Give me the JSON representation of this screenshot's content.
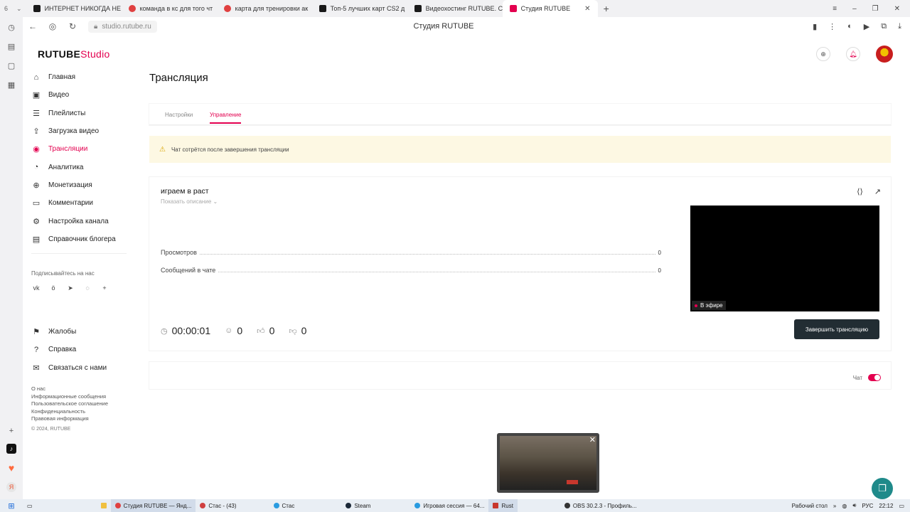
{
  "browser": {
    "tab_counter": "6",
    "tabs": [
      {
        "label": "ИНТЕРНЕТ НИКОГДА НЕ",
        "color": "#1a1a1a"
      },
      {
        "label": "команда в кс для того чт",
        "color": "#e04040"
      },
      {
        "label": "карта для тренировки ак",
        "color": "#e04040"
      },
      {
        "label": "Топ-5 лучших карт CS2 д",
        "color": "#1a1a1a"
      },
      {
        "label": "Видеохостинг RUTUBE. С",
        "color": "#1a1a1a"
      },
      {
        "label": "Студия RUTUBE",
        "color": "#e3004f",
        "active": true
      }
    ],
    "url": "studio.rutube.ru",
    "page_title": "Студия RUTUBE"
  },
  "app": {
    "logo_main": "RUTUBE",
    "logo_studio": "Studio",
    "menu": [
      {
        "label": "Главная",
        "icon": "home-icon",
        "glyph": "⌂"
      },
      {
        "label": "Видео",
        "icon": "video-icon",
        "glyph": "▣"
      },
      {
        "label": "Плейлисты",
        "icon": "playlist-icon",
        "glyph": "☰"
      },
      {
        "label": "Загрузка видео",
        "icon": "upload-icon",
        "glyph": "⇪"
      },
      {
        "label": "Трансляции",
        "icon": "broadcast-icon",
        "glyph": "◉",
        "active": true
      },
      {
        "label": "Аналитика",
        "icon": "analytics-icon",
        "glyph": "◔"
      },
      {
        "label": "Монетизация",
        "icon": "monetization-icon",
        "glyph": "⊕"
      },
      {
        "label": "Комментарии",
        "icon": "comments-icon",
        "glyph": "▭"
      },
      {
        "label": "Настройка канала",
        "icon": "settings-icon",
        "glyph": "⚙"
      },
      {
        "label": "Справочник блогера",
        "icon": "guide-icon",
        "glyph": "▤"
      }
    ],
    "subscribe_label": "Подписывайтесь на нас",
    "socials": [
      "vk-icon",
      "ok-icon",
      "telegram-icon",
      "viber-icon",
      "plus-icon"
    ],
    "menu2": [
      {
        "label": "Жалобы",
        "icon": "flag-icon",
        "glyph": "⚑"
      },
      {
        "label": "Справка",
        "icon": "help-icon",
        "glyph": "?"
      },
      {
        "label": "Связаться с нами",
        "icon": "mail-icon",
        "glyph": "✉"
      }
    ],
    "footer_links": [
      "О нас",
      "Информационные сообщения",
      "Пользовательское соглашение",
      "Конфиденциальность",
      "Правовая информация"
    ],
    "copyright": "© 2024, RUTUBE"
  },
  "page": {
    "title": "Трансляция",
    "tabs": [
      {
        "label": "Настройки"
      },
      {
        "label": "Управление",
        "active": true
      }
    ],
    "warning": "Чат сотрётся после завершения трансляции",
    "stream": {
      "title": "играем в раст",
      "show_description": "Показать описание ⌄",
      "stats": [
        {
          "label": "Просмотров",
          "value": "0"
        },
        {
          "label": "Сообщений в чате",
          "value": "0"
        }
      ],
      "live_label": "В эфире",
      "timer": "00:00:01",
      "viewers": "0",
      "likes": "0",
      "dislikes": "0",
      "end_button": "Завершить трансляцию"
    },
    "chat_label": "Чат"
  },
  "taskbar": {
    "items": [
      {
        "label": "Студия RUTUBE — Янд...",
        "color": "#e04040",
        "active": true
      },
      {
        "label": "Стас - (43)",
        "color": "#d04040"
      },
      {
        "label": "Стас",
        "color": "#2a9be0"
      },
      {
        "label": "Steam",
        "color": "#1b2838"
      },
      {
        "label": "Игровая сессия — 64...",
        "color": "#2a9be0"
      },
      {
        "label": "Rust",
        "color": "#c8372d"
      },
      {
        "label": "OBS 30.2.3 - Профиль...",
        "color": "#333"
      }
    ],
    "desktop_label": "Рабочий стол",
    "lang": "РУС",
    "time": "22:12"
  },
  "colors": {
    "accent": "#e3004f",
    "warning_bg": "#fdf8e3",
    "button_dark": "#222d33"
  }
}
